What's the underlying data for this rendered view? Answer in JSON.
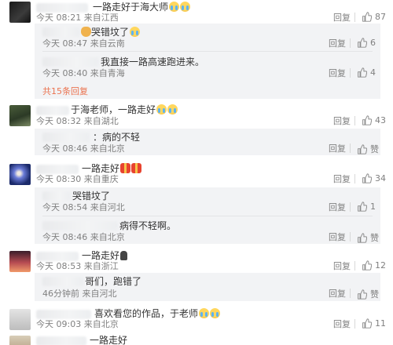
{
  "actions": {
    "reply": "回复"
  },
  "comments": [
    {
      "text": "一路走好于海大师",
      "emoji": [
        "cry",
        "cry"
      ],
      "meta": "今天 08:21 来自江西",
      "likes": "87",
      "replies": [
        {
          "text": "哭错坟了",
          "emoji_before": [
            "bell"
          ],
          "emoji_after": [
            "cry"
          ],
          "meta": "今天 08:47 来自云南",
          "likes": "6"
        },
        {
          "text": "我直接一路高速跑进来。",
          "meta": "今天 08:40 来自青海",
          "likes": "4"
        }
      ],
      "more": "共15条回复"
    },
    {
      "text": "于海老师，一路走好",
      "emoji": [
        "cry",
        "cry"
      ],
      "meta": "今天 08:32 来自湖北",
      "likes": "43",
      "replies": [
        {
          "text": "：病的不轻",
          "meta": "今天 08:46 来自北京",
          "likes": "赞"
        }
      ]
    },
    {
      "text": "一路走好",
      "emoji": [
        "gift",
        "gift"
      ],
      "meta": "今天 08:30 来自重庆",
      "likes": "34",
      "replies": [
        {
          "text": "哭错坟了",
          "meta": "今天 08:54 来自河北",
          "likes": "1"
        },
        {
          "text": "病得不轻啊。",
          "meta": "今天 08:46 来自北京",
          "likes": "赞"
        }
      ]
    },
    {
      "text": "一路走好",
      "emoji": [
        "person"
      ],
      "meta": "今天 08:53 来自浙江",
      "likes": "12",
      "replies": [
        {
          "text": "哥们，跑错了",
          "meta": "46分钟前 来自河北",
          "likes": "赞"
        }
      ]
    },
    {
      "text": "喜欢看您的作品，于老师",
      "emoji": [
        "cry",
        "cry"
      ],
      "meta": "今天 09:03 来自北京",
      "likes": "11"
    },
    {
      "text": "一路走好",
      "emoji": []
    }
  ]
}
